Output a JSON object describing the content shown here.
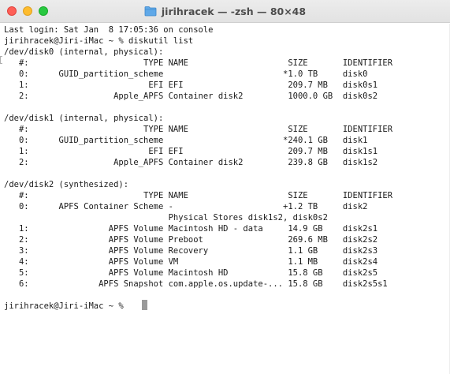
{
  "window": {
    "title": "jirihracek — -zsh — 80×48",
    "title_icon": "folder-icon",
    "traffic_lights": {
      "close": "#fe5f57",
      "minimize": "#febc2e",
      "zoom": "#28c840"
    }
  },
  "terminal": {
    "lines": [
      "Last login: Sat Jan  8 17:05:36 on console",
      "jirihracek@Jiri-iMac ~ % diskutil list",
      "/dev/disk0 (internal, physical):",
      "   #:                       TYPE NAME                    SIZE       IDENTIFIER",
      "   0:      GUID_partition_scheme                        *1.0 TB     disk0",
      "   1:                        EFI EFI                     209.7 MB   disk0s1",
      "   2:                 Apple_APFS Container disk2         1000.0 GB  disk0s2",
      "",
      "/dev/disk1 (internal, physical):",
      "   #:                       TYPE NAME                    SIZE       IDENTIFIER",
      "   0:      GUID_partition_scheme                        *240.1 GB   disk1",
      "   1:                        EFI EFI                     209.7 MB   disk1s1",
      "   2:                 Apple_APFS Container disk2         239.8 GB   disk1s2",
      "",
      "/dev/disk2 (synthesized):",
      "   #:                       TYPE NAME                    SIZE       IDENTIFIER",
      "   0:      APFS Container Scheme -                      +1.2 TB     disk2",
      "                                 Physical Stores disk1s2, disk0s2",
      "   1:                APFS Volume Macintosh HD - data     14.9 GB    disk2s1",
      "   2:                APFS Volume Preboot                 269.6 MB   disk2s2",
      "   3:                APFS Volume Recovery                1.1 GB     disk2s3",
      "   4:                APFS Volume VM                      1.1 MB     disk2s4",
      "   5:                APFS Volume Macintosh HD            15.8 GB    disk2s5",
      "   6:              APFS Snapshot com.apple.os.update-... 15.8 GB    disk2s5s1",
      "",
      "jirihracek@Jiri-iMac ~ % "
    ]
  }
}
